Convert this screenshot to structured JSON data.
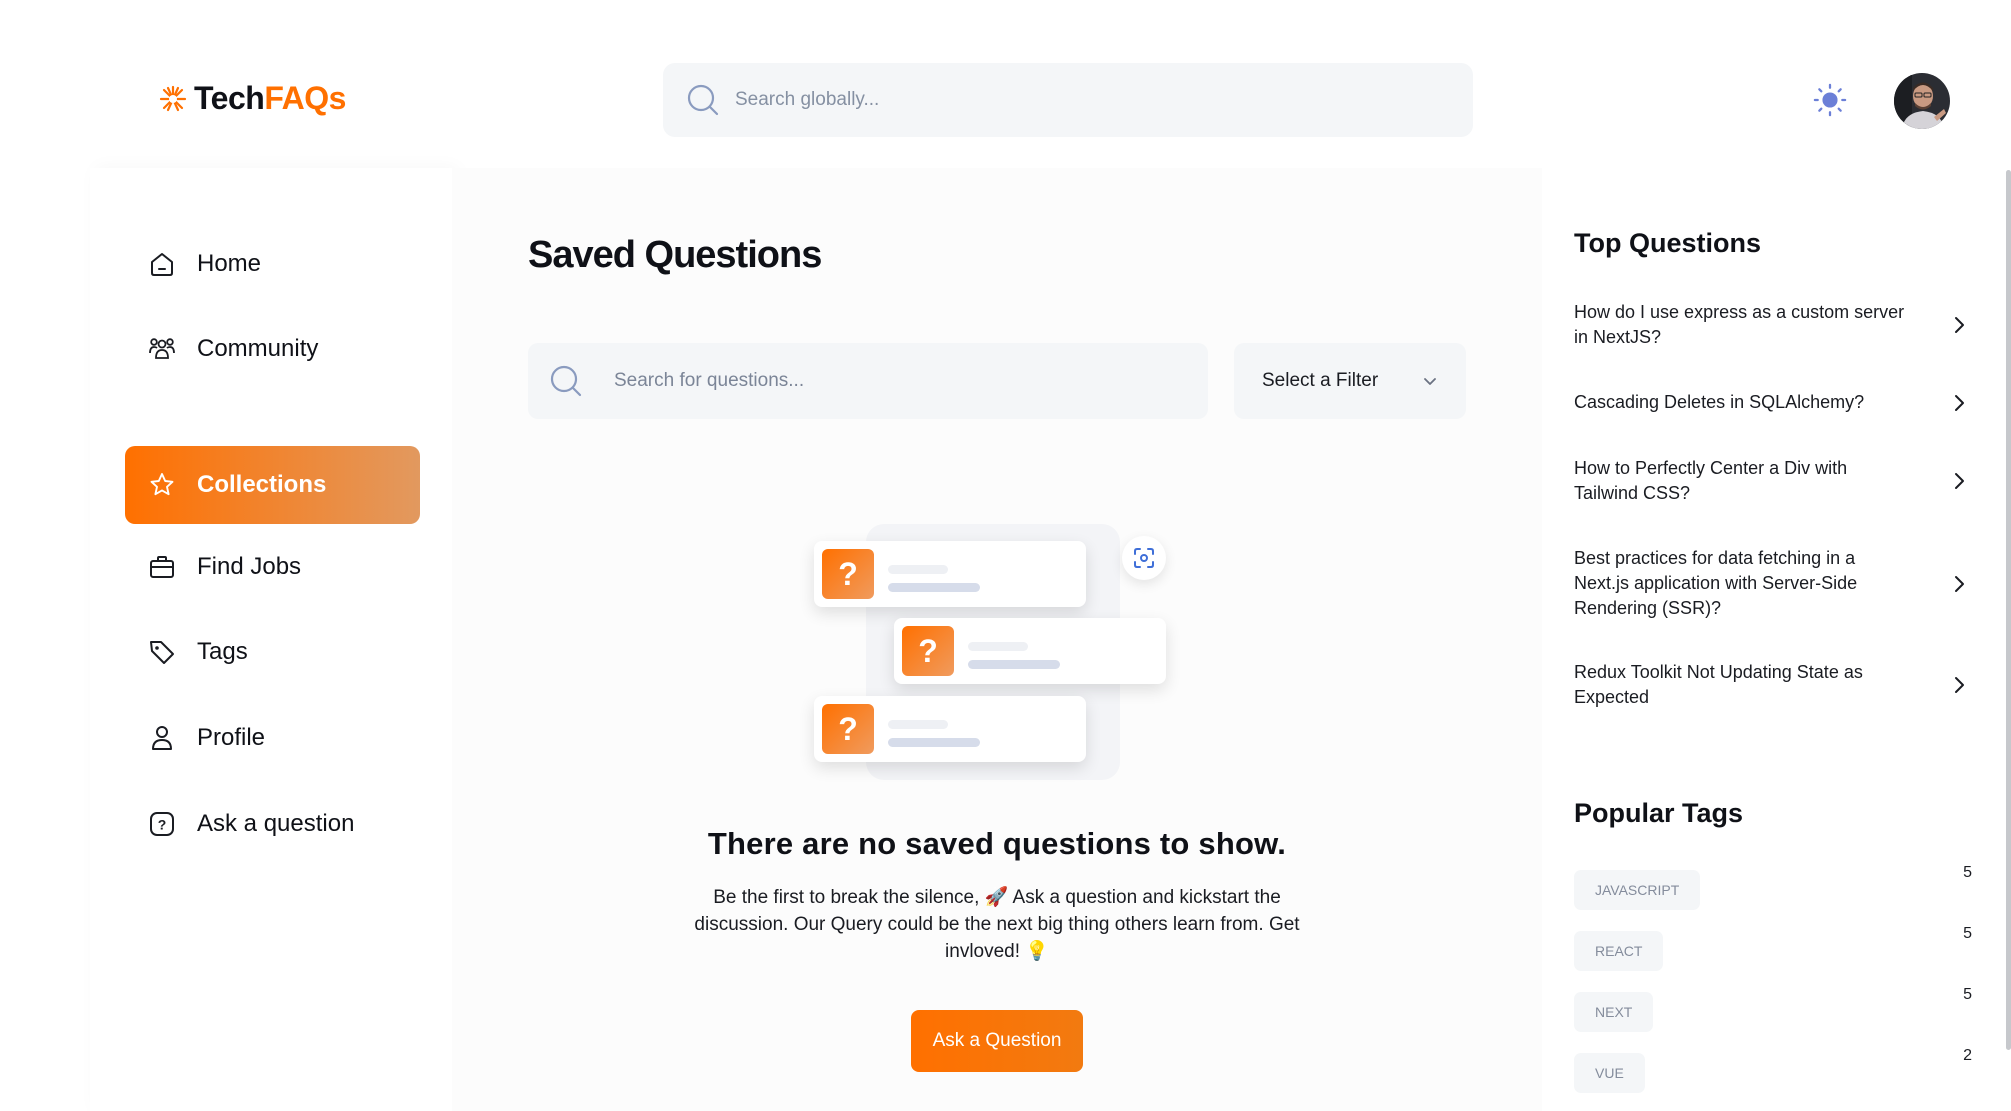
{
  "app": {
    "logo_prefix": "Tech",
    "logo_suffix": "FAQs",
    "global_search_placeholder": "Search globally...",
    "colors": {
      "brand": "#ff7000",
      "brand_light": "#e2995f",
      "surface": "#f4f6f8",
      "text": "#0f1117"
    }
  },
  "header": {
    "theme_icon": "sun-icon",
    "avatar_icon": "user-avatar"
  },
  "sidebar": {
    "items": [
      {
        "label": "Home",
        "icon": "home-icon"
      },
      {
        "label": "Community",
        "icon": "users-icon"
      },
      {
        "label": "Collections",
        "icon": "star-icon",
        "active": true
      },
      {
        "label": "Find Jobs",
        "icon": "briefcase-icon"
      },
      {
        "label": "Tags",
        "icon": "tag-icon"
      },
      {
        "label": "Profile",
        "icon": "user-icon"
      },
      {
        "label": "Ask a question",
        "icon": "question-icon"
      }
    ]
  },
  "main": {
    "title": "Saved Questions",
    "search_placeholder": "Search for questions...",
    "filter_label": "Select a Filter",
    "empty_state": {
      "title": "There are no saved questions to show.",
      "description": "Be the first to break the silence, 🚀 Ask a question and kickstart the discussion. Our Query could be the next big thing others learn from. Get invloved! 💡",
      "button_label": "Ask a Question",
      "illustration_mark": "?"
    }
  },
  "right_sidebar": {
    "top_questions_title": "Top Questions",
    "top_questions": [
      "How do I use express as a custom server in NextJS?",
      "Cascading Deletes in SQLAlchemy?",
      "How to Perfectly Center a Div with Tailwind CSS?",
      "Best practices for data fetching in a Next.js application with Server-Side Rendering (SSR)?",
      "Redux Toolkit Not Updating State as Expected"
    ],
    "popular_tags_title": "Popular Tags",
    "popular_tags": [
      {
        "name": "javascript",
        "count": "5"
      },
      {
        "name": "react",
        "count": "5"
      },
      {
        "name": "next",
        "count": "5"
      },
      {
        "name": "vue",
        "count": "2"
      }
    ]
  }
}
